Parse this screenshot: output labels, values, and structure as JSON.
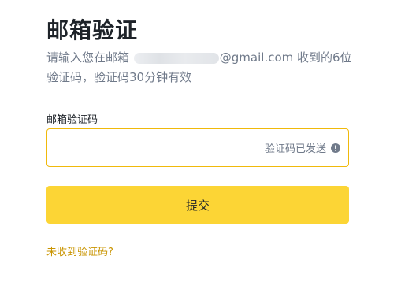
{
  "header": {
    "title": "邮箱验证"
  },
  "description": {
    "prefix": "请输入您在邮箱 ",
    "email_suffix": "@gmail.com",
    "suffix": " 收到的6位验证码，验证码30分钟有效"
  },
  "form": {
    "code_label": "邮箱验证码",
    "code_value": "",
    "sent_status": "验证码已发送",
    "submit_label": "提交"
  },
  "links": {
    "not_received": "未收到验证码?"
  },
  "colors": {
    "accent": "#fcd535",
    "input_border": "#f0b90b",
    "link": "#c99400"
  },
  "icons": {
    "status": "info-icon"
  }
}
